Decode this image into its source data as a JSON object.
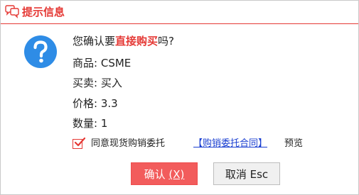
{
  "dialog": {
    "title": "提示信息",
    "question_prefix": "您确认要",
    "question_highlight": "直接购买",
    "question_suffix": "吗?",
    "product_label": "商品:",
    "product_value": "CSME",
    "side_label": "买卖:",
    "side_value": "买入",
    "price_label": "价格:",
    "price_value": "3.3",
    "qty_label": "数量:",
    "qty_value": "1",
    "agree_text": "同意现货购销委托",
    "agree_checked": true,
    "contract_link": "【购销委托合同】",
    "preview_text": "预览",
    "confirm_label": "确认",
    "confirm_hotkey": "(X)",
    "cancel_label": "取消 Esc"
  },
  "icons": {
    "title_icon": "chat-bubbles-icon",
    "main_icon": "question-icon",
    "check_icon": "checkmark-icon"
  },
  "colors": {
    "accent": "#e53935",
    "question_icon": "#2e8ce6",
    "link": "#1a3fd1",
    "confirm_bg": "#f25c5c"
  }
}
